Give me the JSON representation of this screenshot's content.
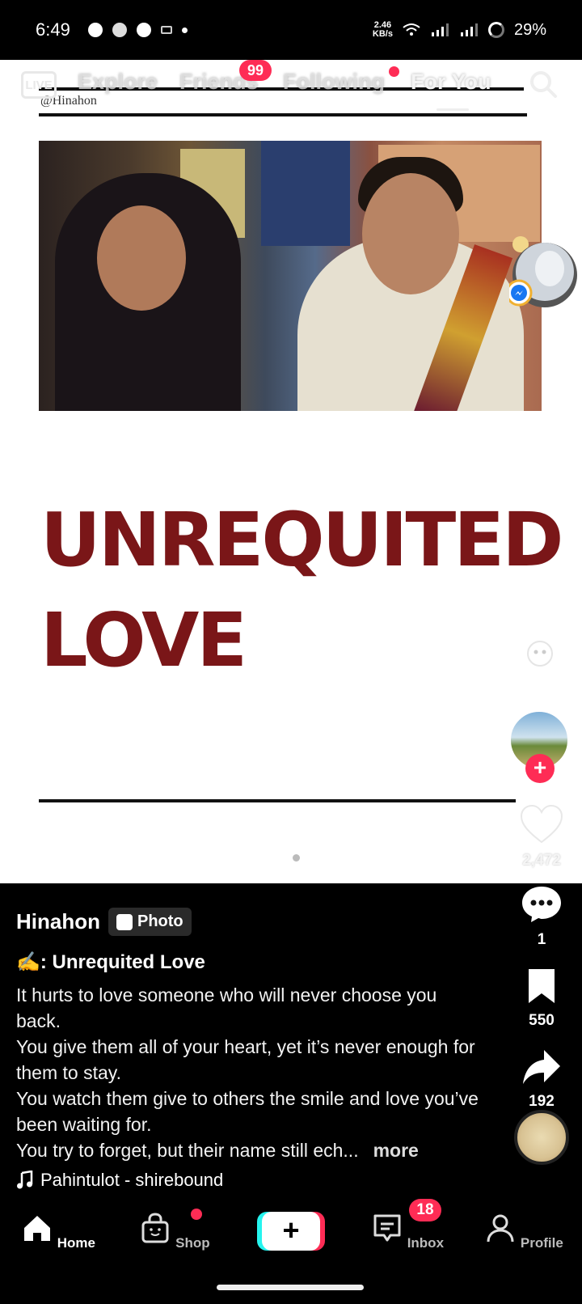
{
  "status_bar": {
    "time": "6:49",
    "net_speed_value": "2.46",
    "net_speed_unit": "KB/s",
    "battery": "29%"
  },
  "top_nav": {
    "live_label": "LIVE",
    "tabs": [
      "Explore",
      "Friends",
      "Following",
      "For You"
    ],
    "active_tab": "For You",
    "friends_badge": "99"
  },
  "post": {
    "watermark": "@Hinahon",
    "title_line1": "UNREQUITED",
    "title_line2": "LOVE",
    "carousel_index": 1,
    "carousel_total": 2
  },
  "actions": {
    "likes": "2,472",
    "comments": "1",
    "bookmarks": "550",
    "shares": "192"
  },
  "caption": {
    "author": "Hinahon",
    "type_chip": "Photo",
    "title": "✍️: Unrequited Love",
    "lines": [
      "It hurts to love someone who will never choose you back.",
      "You give them all of your heart, yet it’s never enough for them to stay.",
      "You watch them give to others the smile and love you’ve been waiting for.",
      "You try to forget, but their name still ech..."
    ],
    "more": "more",
    "music": "Pahintulot - shirebound"
  },
  "bottom_nav": {
    "home": "Home",
    "shop": "Shop",
    "inbox": "Inbox",
    "inbox_badge": "18",
    "profile": "Profile"
  },
  "colors": {
    "accent": "#fe2c55",
    "title_red": "#7a1618",
    "cyan": "#25f4ee"
  }
}
